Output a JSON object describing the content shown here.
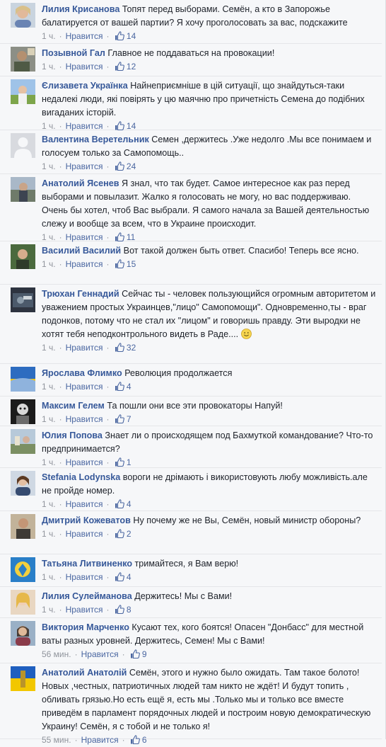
{
  "like_label": "Нравится",
  "colors": {
    "link": "#365899",
    "meta": "#90949c",
    "background": "#f6f7f9"
  },
  "comments": [
    {
      "author": "Лилия Крисанова",
      "text": "Топят перед выборами. Семён, а кто в Запорожье балатируется от вашей партии? Я хочу проголосовать за вас, подскажите",
      "time": "1 ч.",
      "likes": "14"
    },
    {
      "author": "Позывной Гал",
      "text": "Главное не поддаваться на провокации!",
      "time": "1 ч.",
      "likes": "12"
    },
    {
      "author": "Єлизавета Українка",
      "text": "Найнеприємніше в цій ситуації, що знайдуться-таки недалекі люди, які повірять у цю маячню про причетність Семена до подібних вигаданих історій.",
      "time": "1 ч.",
      "likes": "14"
    },
    {
      "author": "Валентина Веретельник",
      "text": "Семен ,держитесь .Уже недолго .Мы все понимаем и голосуем только за Самопомощь..",
      "time": "1 ч.",
      "likes": "24"
    },
    {
      "author": "Анатолий Ясенев",
      "text": "Я знал, что так будет. Самое интересное как раз перед выборами и повылазит. Жалко я голосовать не могу, но вас поддерживаю. Очень бы хотел, чтоб Вас выбрали. Я самого начала за Вашей деятельностью слежу и вообще за всем, что в Украине происходит.",
      "time": "1 ч.",
      "likes": "11"
    },
    {
      "author": "Василий Василий",
      "text": "Вот такой должен быть ответ. Спасибо! Теперь все ясно.",
      "time": "1 ч.",
      "likes": "15"
    },
    {
      "author": "Трюхан Геннадий",
      "text": "Сейчас ты - человек пользующийся огромным авторитетом и уважением простых Украинцев,\"лицо\" Самопомощи\". Одновременно,ты - враг подонков, потому что не стал их \"лицом\" и говоришь правду. Эти выродки не хотят тебя неподконтрольного видеть в Раде....",
      "time": "1 ч.",
      "likes": "32",
      "emoji": "smile-emoji"
    },
    {
      "author": "Ярослава Флимко",
      "text": "Революция продолжается",
      "time": "1 ч.",
      "likes": "4"
    },
    {
      "author": "Максим Гелем",
      "text": "Та пошли они все эти провокаторы Напуй!",
      "time": "1 ч.",
      "likes": "7"
    },
    {
      "author": "Юлия Попова",
      "text": "Знает ли о происходящем под Бахмуткой командование? Что-то предпринимается?",
      "time": "1 ч.",
      "likes": "1"
    },
    {
      "author": "Stefania Lodynska",
      "text": "вороги не дрімають і використовують любу можливість.але не пройде номер.",
      "time": "1 ч.",
      "likes": "4"
    },
    {
      "author": "Дмитрий Кожеватов",
      "text": "Ну почему же не Вы, Семён, новый министр обороны?",
      "time": "1 ч.",
      "likes": "2"
    },
    {
      "author": "Татьяна Литвиненко",
      "text": "тримайтеся, я Вам верю!",
      "time": "1 ч.",
      "likes": "4"
    },
    {
      "author": "Лилия Сулейманова",
      "text": "Держитесь! Мы с Вами!",
      "time": "1 ч.",
      "likes": "8"
    },
    {
      "author": "Виктория Марченко",
      "text": "Кусают тех, кого боятся! Опасен \"Донбасс\" для местной ваты разных уровней. Держитесь, Семен! Мы с Вами!",
      "time": "56 мин.",
      "likes": "9"
    },
    {
      "author": "Анатолий Анатолiй",
      "text": "Семён, этого и нужно было ожидать. Там такое болото! Новых ,честных, патриотичных людей там никто не ждёт! И будут топить , обливать грязью.Но есть ещё я, есть мы .Только мы и только все вместе приведём в парламент порядочных людей и построим новую демократическую Украину! Семён, я с тобой и не только я!",
      "time": "55 мин.",
      "likes": "6"
    }
  ]
}
